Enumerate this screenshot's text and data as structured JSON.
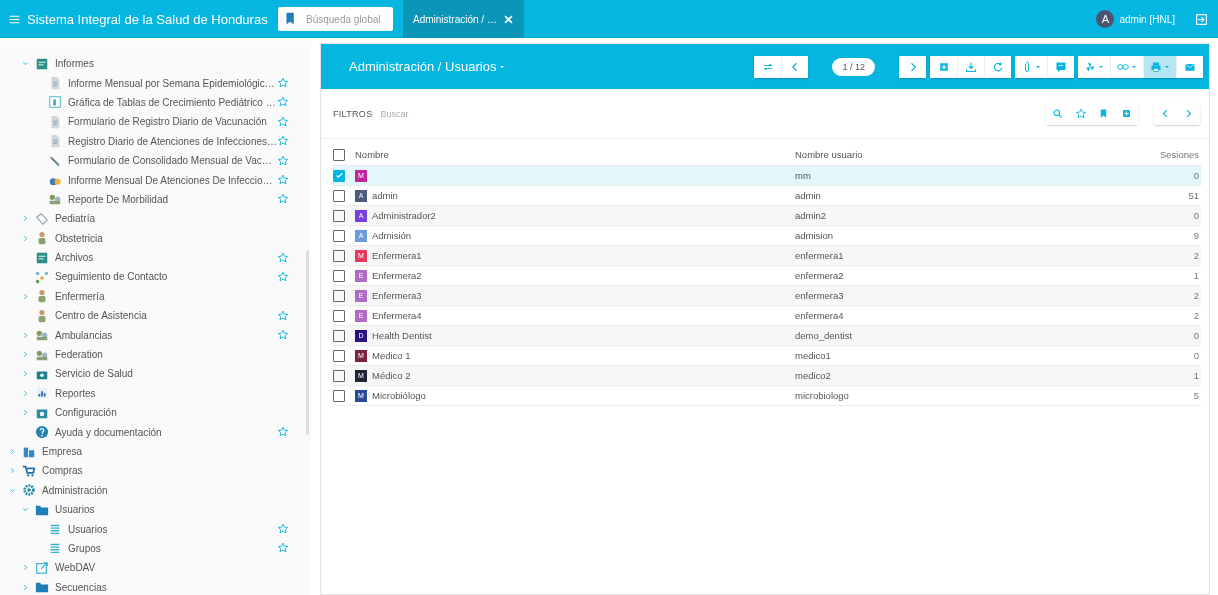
{
  "top_bar": {
    "app_title": "Sistema Integral de la Salud de Honduras",
    "search": {
      "placeholder": "Búsqueda global"
    },
    "tabs": [
      {
        "label": "Administración / …",
        "selected": true
      }
    ],
    "user": {
      "initial": "A",
      "name": "admin [HNL]"
    }
  },
  "sidebar": {
    "scrolled_parent_children": [
      {
        "label": "Informes",
        "expanded": true,
        "favorite": false,
        "children": [
          {
            "label": "Informe Mensual por Semana Epidemiológic…",
            "favorite": true
          },
          {
            "label": "Gráfica de Tablas de Crecimiento Pediátrico …",
            "favorite": true
          },
          {
            "label": "Formulario de Registro Diario de Vacunación",
            "favorite": true
          },
          {
            "label": "Registro Diario de Atenciones de Infecciones…",
            "favorite": true
          },
          {
            "label": "Formulario de Consolidado Mensual de Vac…",
            "favorite": true
          },
          {
            "label": "Informe Mensual De Atenciones De Infeccio…",
            "favorite": true
          },
          {
            "label": "Reporte De Morbilidad",
            "favorite": true
          }
        ]
      },
      {
        "label": "Pediatría",
        "expanded": false,
        "favorite": false
      },
      {
        "label": "Obstetricia",
        "expanded": false,
        "favorite": false
      },
      {
        "label": "Archivos",
        "favorite": true
      },
      {
        "label": "Seguimiento de Contacto",
        "favorite": true
      },
      {
        "label": "Enfermería",
        "expanded": false,
        "favorite": false
      },
      {
        "label": "Centro de Asistencia",
        "favorite": true
      },
      {
        "label": "Ambulancias",
        "expanded": false,
        "favorite": true
      },
      {
        "label": "Federation",
        "expanded": false,
        "favorite": false
      },
      {
        "label": "Servicio de Salud",
        "expanded": false,
        "favorite": false
      },
      {
        "label": "Reportes",
        "expanded": false,
        "favorite": false
      },
      {
        "label": "Configuración",
        "expanded": false,
        "favorite": false
      },
      {
        "label": "Ayuda y documentación",
        "favorite": true
      }
    ],
    "items": [
      {
        "label": "Empresa",
        "expanded": false,
        "favorite": false
      },
      {
        "label": "Compras",
        "expanded": false,
        "favorite": false
      },
      {
        "label": "Administración",
        "expanded": true,
        "favorite": false,
        "children": [
          {
            "label": "Usuarios",
            "expanded": true,
            "favorite": false,
            "children": [
              {
                "label": "Usuarios",
                "favorite": true
              },
              {
                "label": "Grupos",
                "favorite": true
              }
            ]
          },
          {
            "label": "WebDAV",
            "expanded": false,
            "favorite": false
          },
          {
            "label": "Secuencias",
            "expanded": false,
            "favorite": false
          }
        ]
      }
    ]
  },
  "view": {
    "title": "Administración / Usuarios",
    "pager": "1 / 12",
    "toolbar_groups": [
      [
        {
          "dropdown": false,
          "active": false
        },
        {
          "dropdown": false,
          "active": false
        }
      ],
      [
        {
          "dropdown": false,
          "active": false
        }
      ],
      [
        {
          "dropdown": false,
          "active": false
        },
        {
          "dropdown": false,
          "active": false
        },
        {
          "dropdown": false,
          "active": false
        }
      ],
      [
        {
          "dropdown": true,
          "active": false
        },
        {
          "dropdown": false,
          "active": false
        }
      ],
      [
        {
          "dropdown": true,
          "active": false
        },
        {
          "dropdown": true,
          "active": false
        },
        {
          "dropdown": true,
          "active": true
        },
        {
          "dropdown": false,
          "active": false
        }
      ]
    ],
    "filters": {
      "label": "FILTROS",
      "placeholder": "Buscar"
    },
    "table": {
      "columns": [
        "Nombre",
        "Nombre usuario",
        "Sesiones"
      ],
      "all_selected": false,
      "rows": [
        {
          "selected": true,
          "initial": "M",
          "color": "#c0269c",
          "username": "mm",
          "sessions": "0"
        },
        {
          "selected": false,
          "initial": "A",
          "color": "#4c5b7c",
          "name": "admin",
          "username": "admin",
          "sessions": "51"
        },
        {
          "selected": false,
          "initial": "A",
          "color": "#7a3fe0",
          "name": "Administrador2",
          "username": "admin2",
          "sessions": "0"
        },
        {
          "selected": false,
          "initial": "A",
          "color": "#6d9ad8",
          "name": "Admisión",
          "username": "admision",
          "sessions": "9"
        },
        {
          "selected": false,
          "initial": "M",
          "color": "#e63a5c",
          "name": "Enfermera1",
          "username": "enfermera1",
          "sessions": "2"
        },
        {
          "selected": false,
          "initial": "E",
          "color": "#b06cc4",
          "name": "Enfermera2",
          "username": "enfermera2",
          "sessions": "1"
        },
        {
          "selected": false,
          "initial": "E",
          "color": "#b16bc6",
          "name": "Enfermera3",
          "username": "enfermera3",
          "sessions": "2"
        },
        {
          "selected": false,
          "initial": "E",
          "color": "#b26ac5",
          "name": "Enfermera4",
          "username": "enfermera4",
          "sessions": "2"
        },
        {
          "selected": false,
          "initial": "D",
          "color": "#2a137e",
          "name": "Health Dentist",
          "username": "demo_dentist",
          "sessions": "0"
        },
        {
          "selected": false,
          "initial": "M",
          "color": "#7a2242",
          "name": "Medico 1",
          "username": "medico1",
          "sessions": "0"
        },
        {
          "selected": false,
          "initial": "M",
          "color": "#1f2532",
          "name": "Médico 2",
          "username": "medico2",
          "sessions": "1"
        },
        {
          "selected": false,
          "initial": "M",
          "color": "#2b4b98",
          "name": "Microbiólogo",
          "username": "microbiologo",
          "sessions": "5"
        }
      ]
    }
  }
}
